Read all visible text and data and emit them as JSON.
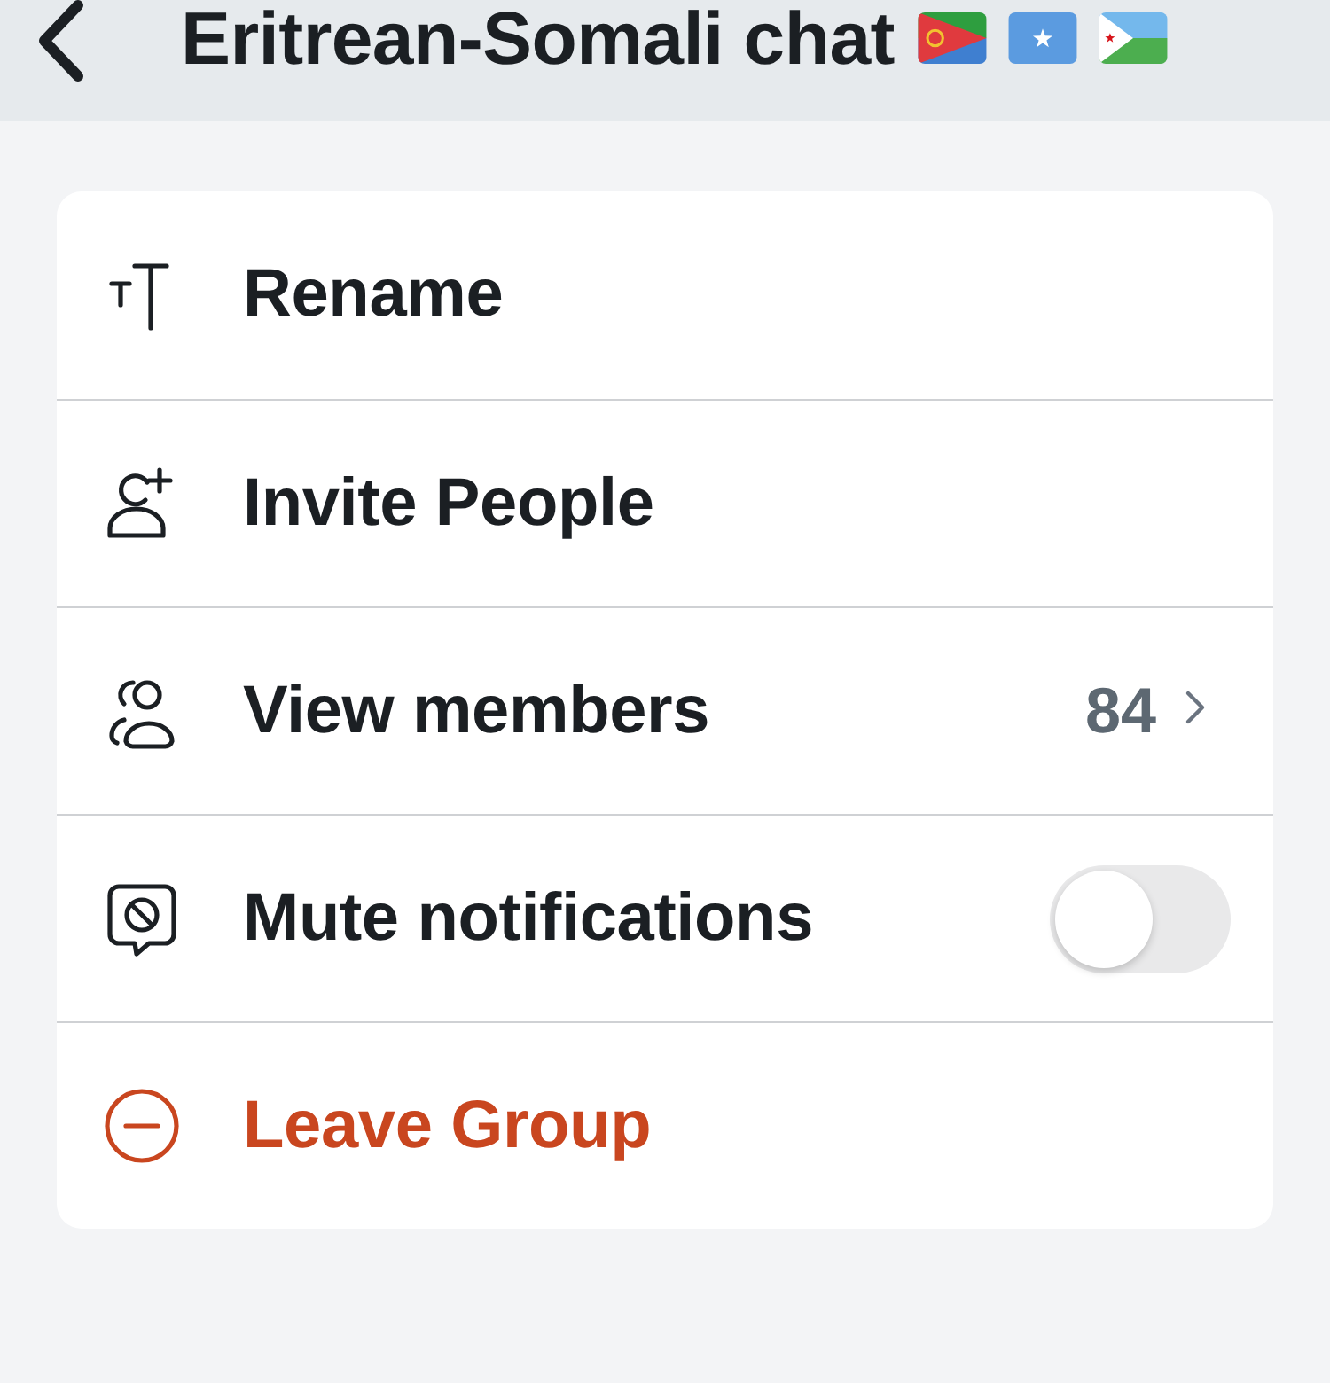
{
  "header": {
    "title": "Eritrean-Somali chat",
    "flags": [
      {
        "kind": "eritrea"
      },
      {
        "kind": "somalia"
      },
      {
        "kind": "djibouti"
      }
    ]
  },
  "menu": {
    "items": [
      {
        "kind": "action",
        "label": "Rename"
      },
      {
        "kind": "action",
        "label": "Invite People"
      },
      {
        "kind": "navigation",
        "label": "View members",
        "count": "84"
      },
      {
        "kind": "toggle",
        "label": "Mute notifications",
        "on": false
      },
      {
        "kind": "destructive",
        "label": "Leave Group"
      }
    ]
  }
}
